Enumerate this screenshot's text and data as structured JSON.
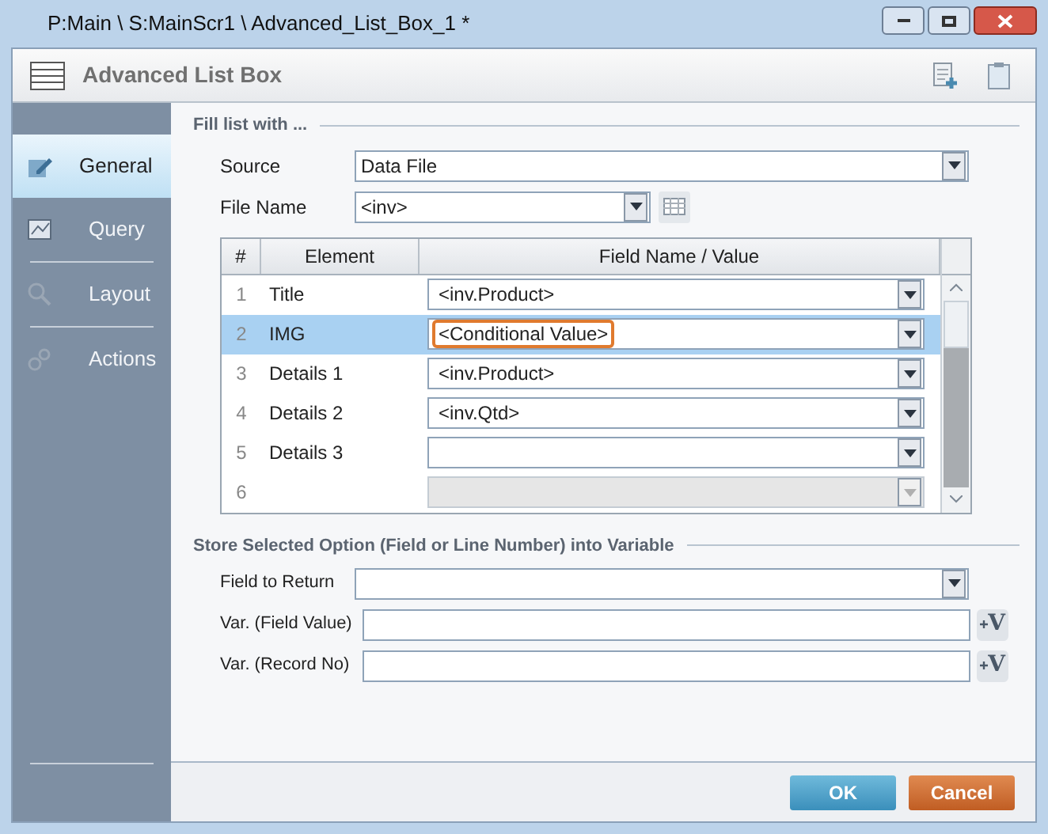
{
  "window": {
    "title": "P:Main \\ S:MainScr1 \\ Advanced_List_Box_1 *"
  },
  "header": {
    "title": "Advanced List Box"
  },
  "sidebar": {
    "items": [
      {
        "label": "General",
        "selected": true,
        "kind": "general"
      },
      {
        "label": "Query",
        "selected": false,
        "kind": "query"
      },
      {
        "label": "Layout",
        "selected": false,
        "kind": "layout"
      },
      {
        "label": "Actions",
        "selected": false,
        "kind": "actions"
      }
    ]
  },
  "fill_section": {
    "title": "Fill list with ...",
    "source": {
      "label": "Source",
      "value": "Data File"
    },
    "file_name": {
      "label": "File Name",
      "value": "<inv>"
    }
  },
  "table": {
    "columns": [
      "#",
      "Element",
      "Field Name / Value"
    ],
    "rows": [
      {
        "index": "1",
        "element": "Title",
        "value": "<inv.Product>",
        "selected": false,
        "outlined": false,
        "disabled": false
      },
      {
        "index": "2",
        "element": "IMG",
        "value": "<Conditional Value>",
        "selected": true,
        "outlined": true,
        "disabled": false
      },
      {
        "index": "3",
        "element": "Details 1",
        "value": "<inv.Product>",
        "selected": false,
        "outlined": false,
        "disabled": false
      },
      {
        "index": "4",
        "element": "Details 2",
        "value": "<inv.Qtd>",
        "selected": false,
        "outlined": false,
        "disabled": false
      },
      {
        "index": "5",
        "element": "Details 3",
        "selected": false,
        "disabled": false
      },
      {
        "index": "6",
        "selected": false,
        "disabled": true
      }
    ]
  },
  "store_section": {
    "title": "Store Selected Option (Field or Line Number) into Variable",
    "fields": [
      {
        "kind": "dropdown",
        "label": "Field to Return"
      },
      {
        "kind": "variable",
        "label": "Var. (Field Value)",
        "picker": "V"
      },
      {
        "kind": "variable",
        "label": "Var. (Record No)",
        "picker": "V"
      }
    ]
  },
  "buttons": [
    {
      "label": "OK",
      "kind": "primary"
    },
    {
      "label": "Cancel",
      "kind": "cancel"
    }
  ]
}
